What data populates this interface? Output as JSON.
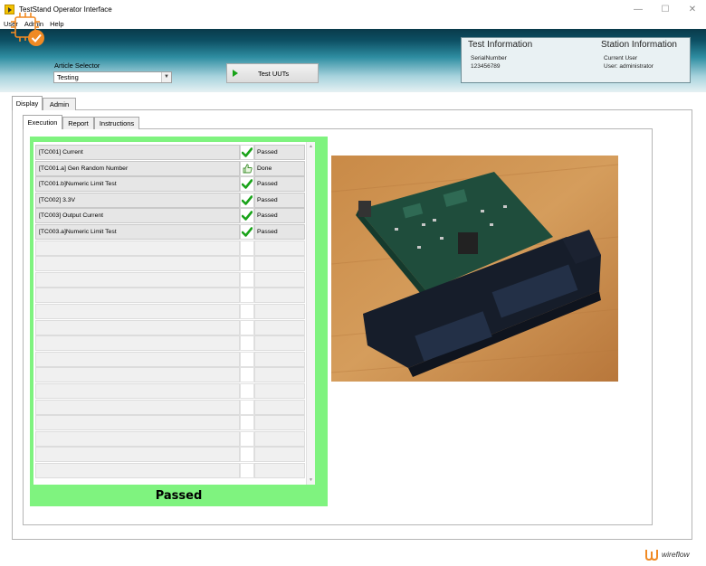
{
  "window": {
    "title": "TestStand Operator Interface",
    "minimize": "—",
    "maximize": "☐",
    "close": "✕"
  },
  "menu": [
    "User",
    "Admin",
    "Help"
  ],
  "header": {
    "article_label": "Article Selector",
    "article_value": "Testing",
    "test_button": "Test UUTs",
    "test_info": {
      "title": "Test Information",
      "serial_label": "SerialNumber",
      "serial_value": "123456789"
    },
    "station_info": {
      "title": "Station Information",
      "user_label": "Current User",
      "user_value": "User: administrator"
    }
  },
  "tabs": [
    "Display",
    "Admin"
  ],
  "sub_tabs": [
    "Execution",
    "Report",
    "Instructions"
  ],
  "steps": [
    {
      "name": "[TC001] Current",
      "icon": "check-icon",
      "status": "Passed"
    },
    {
      "name": "[TC001.a] Gen Random Number",
      "icon": "thumbs-up-icon",
      "status": "Done"
    },
    {
      "name": "[TC001.b]Numeric Limit Test",
      "icon": "check-icon",
      "status": "Passed"
    },
    {
      "name": "[TC002] 3.3V",
      "icon": "check-icon",
      "status": "Passed"
    },
    {
      "name": "[TC003] Output Current",
      "icon": "check-icon",
      "status": "Passed"
    },
    {
      "name": "[TC003.a]Numeric Limit Test",
      "icon": "check-icon",
      "status": "Passed"
    }
  ],
  "empty_rows": 15,
  "overall_result": "Passed",
  "colors": {
    "result_green": "#7ff37f",
    "check_green": "#1aa31a"
  },
  "brand": "wireflow"
}
